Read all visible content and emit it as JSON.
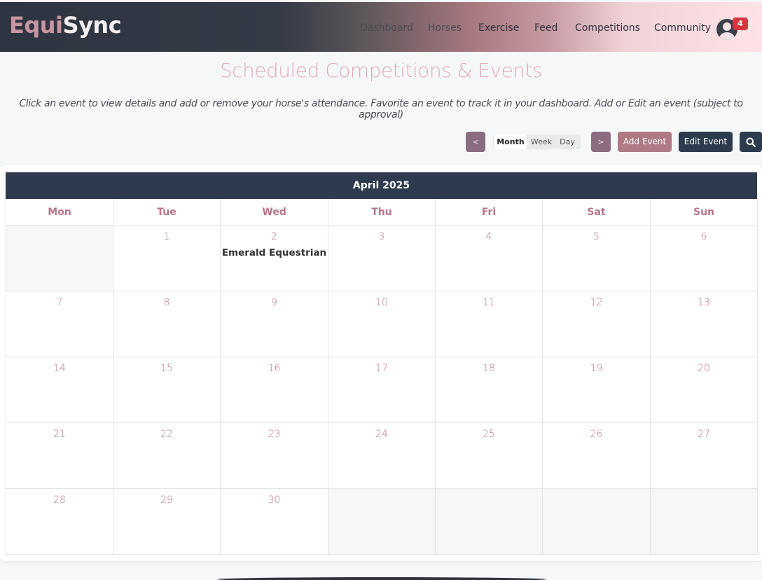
{
  "brand": {
    "part1": "Equi",
    "part2": "Sync"
  },
  "nav": {
    "items": [
      {
        "label": "Dashboard"
      },
      {
        "label": "Horses"
      },
      {
        "label": "Exercise"
      },
      {
        "label": "Feed"
      },
      {
        "label": "Competitions"
      },
      {
        "label": "Community"
      }
    ],
    "notifications": "4"
  },
  "page": {
    "title": "Scheduled Competitions & Events",
    "subtitle": "Click an event to view details and add or remove your horse's attendance. Favorite an event to track it in your dashboard. Add or Edit an event (subject to approval)"
  },
  "toolbar": {
    "prev": "<",
    "next": ">",
    "views": [
      "Month",
      "Week",
      "Day"
    ],
    "active_view": "Month",
    "add_event": "Add Event",
    "edit_event": "Edit Event",
    "search_icon": "search-icon"
  },
  "calendar": {
    "title": "April 2025",
    "days": [
      "Mon",
      "Tue",
      "Wed",
      "Thu",
      "Fri",
      "Sat",
      "Sun"
    ],
    "weeks": [
      [
        "",
        "1",
        "2",
        "3",
        "4",
        "5",
        "6"
      ],
      [
        "7",
        "8",
        "9",
        "10",
        "11",
        "12",
        "13"
      ],
      [
        "14",
        "15",
        "16",
        "17",
        "18",
        "19",
        "20"
      ],
      [
        "21",
        "22",
        "23",
        "24",
        "25",
        "26",
        "27"
      ],
      [
        "28",
        "29",
        "30",
        "",
        "",
        "",
        ""
      ]
    ],
    "events": [
      {
        "day": "2",
        "label": "Emerald Equestrian"
      }
    ]
  },
  "colors": {
    "accent": "#b77688",
    "dark": "#2e3b4e",
    "title_pink": "#e0aab6",
    "nav_button": "#8b6b80",
    "add_button": "#b07a85",
    "badge": "#d9363e"
  }
}
